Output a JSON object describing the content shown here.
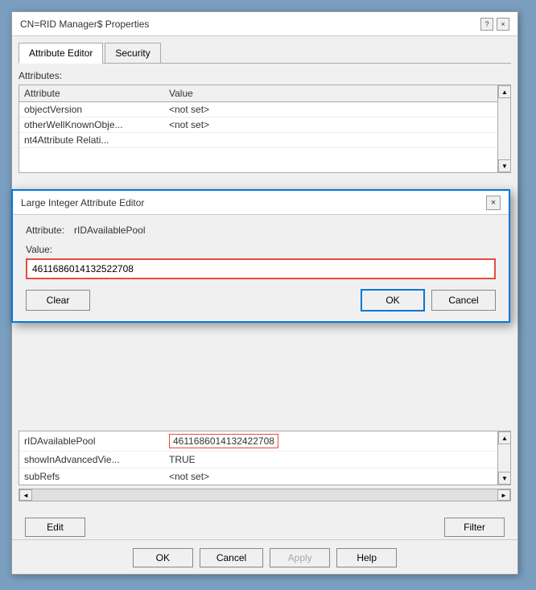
{
  "bgWindow": {
    "title": "CN=RID Manager$ Properties",
    "controls": {
      "help": "?",
      "close": "×"
    }
  },
  "tabs": [
    {
      "label": "Attribute Editor",
      "active": true
    },
    {
      "label": "Security",
      "active": false
    }
  ],
  "attributesLabel": "Attributes:",
  "tableHeaders": [
    "Attribute",
    "Value"
  ],
  "tableRows": [
    {
      "attribute": "objectVersion",
      "value": "<not set>"
    },
    {
      "attribute": "otherWellKnownObje...",
      "value": "<not set>"
    },
    {
      "attribute": "nt4Attribute Relati...",
      "value": ""
    }
  ],
  "dialog": {
    "title": "Large Integer Attribute Editor",
    "closeBtn": "×",
    "attributeLabel": "Attribute:",
    "attributeValue": "rIDAvailablePool",
    "valueLabel": "Value:",
    "inputValue": "4611686014132522708",
    "buttons": {
      "clear": "Clear",
      "ok": "OK",
      "cancel": "Cancel"
    }
  },
  "lowerTable": {
    "rows": [
      {
        "attribute": "rIDAvailablePool",
        "value": "4611686014132422708",
        "highlighted": true
      },
      {
        "attribute": "showInAdvancedVie...",
        "value": "TRUE"
      },
      {
        "attribute": "subRefs",
        "value": "<not set>"
      }
    ]
  },
  "bottomButtons": {
    "edit": "Edit",
    "filter": "Filter",
    "ok": "OK",
    "cancel": "Cancel",
    "apply": "Apply",
    "help": "Help"
  }
}
